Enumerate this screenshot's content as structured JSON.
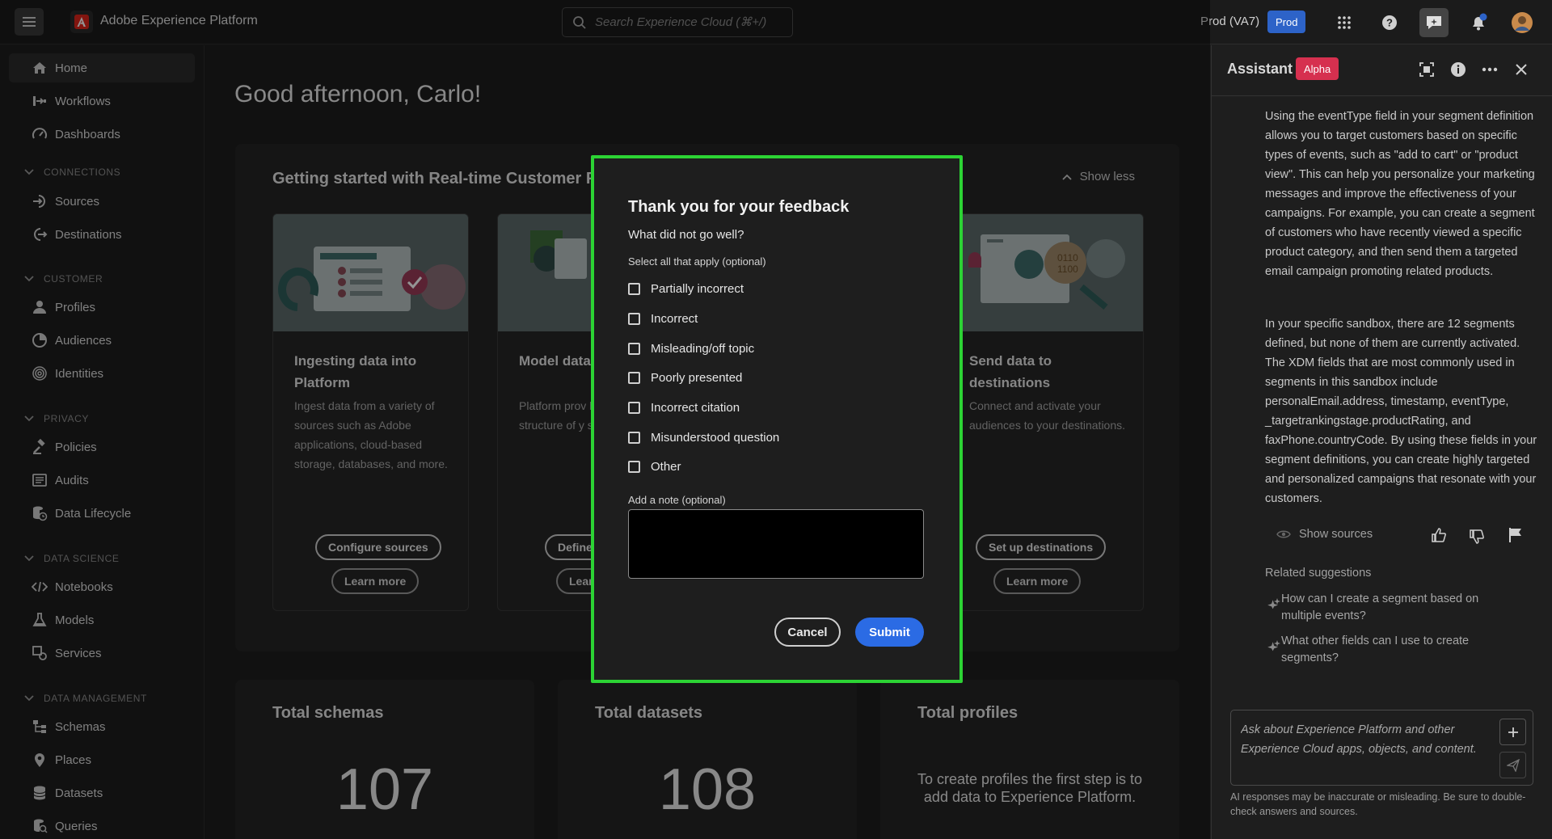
{
  "topbar": {
    "menu_icon": "hamburger-icon",
    "logo_icon": "adobe-logo-icon",
    "app_title": "Adobe Experience Platform",
    "search_placeholder": "Search Experience Cloud (⌘+/)",
    "environment": "Prod (VA7)",
    "env_badge": "Prod",
    "icons": [
      "apps-grid-icon",
      "help-icon",
      "assistant-chat-icon",
      "notifications-bell-icon",
      "user-avatar"
    ]
  },
  "sidebar": {
    "home": "Home",
    "workflows": "Workflows",
    "dashboards": "Dashboards",
    "connections_header": "CONNECTIONS",
    "sources": "Sources",
    "destinations": "Destinations",
    "customer_header": "CUSTOMER",
    "profiles": "Profiles",
    "audiences": "Audiences",
    "identities": "Identities",
    "privacy_header": "PRIVACY",
    "policies": "Policies",
    "audits": "Audits",
    "data_lifecycle": "Data Lifecycle",
    "data_science_header": "DATA SCIENCE",
    "notebooks": "Notebooks",
    "models": "Models",
    "services": "Services",
    "data_management_header": "DATA MANAGEMENT",
    "schemas": "Schemas",
    "places": "Places",
    "datasets": "Datasets",
    "queries": "Queries"
  },
  "main": {
    "greeting": "Good afternoon, Carlo!",
    "getting_started_title": "Getting started with Real-time Customer Pro",
    "show_less": "Show less",
    "cards": [
      {
        "title": "Ingesting data into Platform",
        "desc": "Ingest data from a variety of sources such as Adobe applications, cloud-based storage, databases, and more.",
        "primary": "Configure sources",
        "secondary": "Learn more"
      },
      {
        "title": "Model data",
        "desc": "Platform prov blocks to desc structure of y schema.",
        "primary": "Define",
        "secondary": "Lear"
      },
      {
        "title": "Send data to destinations",
        "desc": "Connect and activate your audiences to your destinations.",
        "primary": "Set up destinations",
        "secondary": "Learn more"
      }
    ],
    "stats": [
      {
        "title": "Total schemas",
        "value": "107"
      },
      {
        "title": "Total datasets",
        "value": "108"
      },
      {
        "title": "Total profiles",
        "text": "To create profiles the first step is to add data to Experience Platform."
      }
    ]
  },
  "modal": {
    "title": "Thank you for your feedback",
    "question": "What did not go well?",
    "select_label": "Select all that apply (optional)",
    "options": [
      "Partially incorrect",
      "Incorrect",
      "Misleading/off topic",
      "Poorly presented",
      "Incorrect citation",
      "Misunderstood question",
      "Other"
    ],
    "note_label": "Add a note (optional)",
    "note_value": "",
    "cancel": "Cancel",
    "submit": "Submit",
    "highlight_color": "#2cd334"
  },
  "assistant": {
    "title": "Assistant",
    "badge": "Alpha",
    "paragraph1": "Using the eventType field in your segment definition allows you to target customers based on specific types of events, such as \"add to cart\" or \"product view\". This can help you personalize your marketing messages and improve the effectiveness of your campaigns. For example, you can create a segment of customers who have recently viewed a specific product category, and then send them a targeted email campaign promoting related products.",
    "paragraph2": "In your specific sandbox, there are 12 segments defined, but none of them are currently activated. The XDM fields that are most commonly used in segments in this sandbox include personalEmail.address, timestamp, eventType, _targetrankingstage.productRating, and faxPhone.countryCode. By using these fields in your segment definitions, you can create highly targeted and personalized campaigns that resonate with your customers.",
    "show_sources": "Show sources",
    "related_label": "Related suggestions",
    "suggestions": [
      "How can I create a segment based on multiple events?",
      "What other fields can I use to create segments?"
    ],
    "input_placeholder": "Ask about Experience Platform and other Experience Cloud apps, objects, and content.",
    "disclaimer": "AI responses may be inaccurate or misleading. Be sure to double-check answers and sources.",
    "badge_color": "#d6304f"
  }
}
